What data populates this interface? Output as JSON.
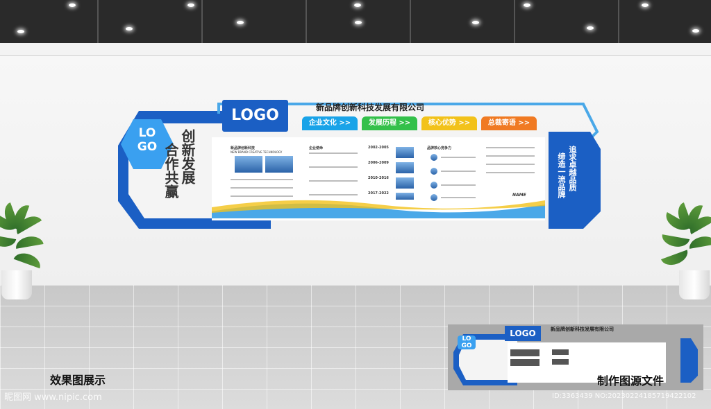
{
  "scene": {
    "company_name": "新品牌创新科技发展有限公司",
    "logo_text": "LOGO",
    "hex_logo_text": "LO GO",
    "slogan_left": [
      "创新发展",
      "合作共赢"
    ],
    "slogan_right": [
      "追求卓越品质",
      "缔造一流品牌"
    ],
    "tabs": [
      {
        "label": "企业文化 >>",
        "color": "#19a3e8"
      },
      {
        "label": "发展历程 >>",
        "color": "#33c04a"
      },
      {
        "label": "核心优势 >>",
        "color": "#f2c21a"
      },
      {
        "label": "总裁寄语 >>",
        "color": "#f07a23"
      }
    ],
    "panel_sections": [
      {
        "heading": "新品牌创新科技",
        "sub": "NEW BRAND CREATIVE TECHNOLOGY"
      },
      {
        "heading": "企业使命"
      },
      {
        "heading": "2002-2005"
      },
      {
        "heading": "品牌核心竞争力"
      }
    ],
    "timeline_years": [
      "2002-2005",
      "2006-2009",
      "2010-2016",
      "2017-2022"
    ],
    "signature": "NAME"
  },
  "captions": {
    "left": "效果图展示",
    "right": "制作图源文件"
  },
  "watermark": {
    "site": "昵图网 www.nipic.com",
    "id": "ID:3363439 NO:20230224185719422102"
  },
  "colors": {
    "brand_blue": "#1b5fc4",
    "light_blue": "#4aa8e8"
  }
}
